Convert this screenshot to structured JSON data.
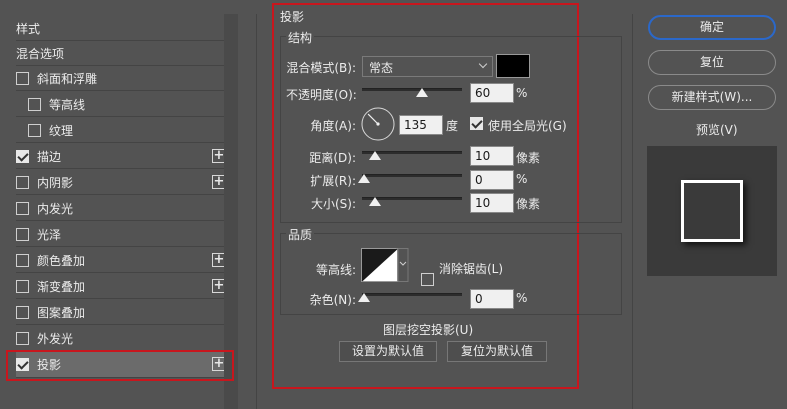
{
  "styles_list": {
    "header": "样式",
    "blend_options": "混合选项",
    "items": [
      {
        "label": "斜面和浮雕",
        "checked": false,
        "plus": false,
        "indent": false
      },
      {
        "label": "等高线",
        "checked": false,
        "plus": false,
        "indent": true
      },
      {
        "label": "纹理",
        "checked": false,
        "plus": false,
        "indent": true
      },
      {
        "label": "描边",
        "checked": true,
        "plus": true,
        "indent": false
      },
      {
        "label": "内阴影",
        "checked": false,
        "plus": true,
        "indent": false
      },
      {
        "label": "内发光",
        "checked": false,
        "plus": false,
        "indent": false
      },
      {
        "label": "光泽",
        "checked": false,
        "plus": false,
        "indent": false
      },
      {
        "label": "颜色叠加",
        "checked": false,
        "plus": true,
        "indent": false
      },
      {
        "label": "渐变叠加",
        "checked": false,
        "plus": true,
        "indent": false
      },
      {
        "label": "图案叠加",
        "checked": false,
        "plus": false,
        "indent": false
      },
      {
        "label": "外发光",
        "checked": false,
        "plus": false,
        "indent": false
      },
      {
        "label": "投影",
        "checked": true,
        "plus": true,
        "indent": false
      }
    ],
    "plus_symbol": "+"
  },
  "drop_shadow": {
    "title": "投影",
    "structure": {
      "title": "结构",
      "blend_mode_label": "混合模式(B):",
      "blend_mode_value": "常态",
      "shadow_color": "#000000",
      "opacity_label": "不透明度(O):",
      "opacity_value": "60",
      "opacity_unit": "%",
      "opacity_fraction": 0.6,
      "angle_label": "角度(A):",
      "angle_value": "135",
      "angle_unit": "度",
      "global_light_label": "使用全局光(G)",
      "global_light_checked": true,
      "distance_label": "距离(D):",
      "distance_value": "10",
      "distance_unit": "像素",
      "spread_label": "扩展(R):",
      "spread_value": "0",
      "spread_unit": "%",
      "size_label": "大小(S):",
      "size_value": "10",
      "size_unit": "像素"
    },
    "quality": {
      "title": "品质",
      "contour_label": "等高线:",
      "anti_alias_label": "消除锯齿(L)",
      "anti_alias_checked": false,
      "noise_label": "杂色(N):",
      "noise_value": "0",
      "noise_unit": "%"
    },
    "knockout_label": "图层挖空投影(U)",
    "knockout_checked": true,
    "set_default_label": "设置为默认值",
    "reset_default_label": "复位为默认值"
  },
  "actions": {
    "ok_label": "确定",
    "reset_label": "复位",
    "new_style_label": "新建样式(W)...",
    "preview_label": "预览(V)",
    "preview_checked": true
  },
  "colors": {
    "highlight_red": "#c8161d",
    "primary_blue": "#2b68c9"
  }
}
